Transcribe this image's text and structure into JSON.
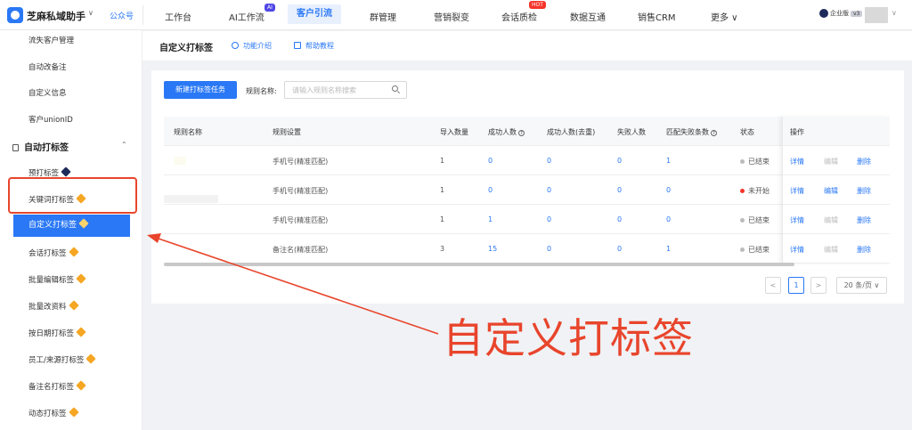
{
  "header": {
    "app_name": "芝麻私域助手",
    "app_caret": "∨",
    "mp_link": "公众号",
    "nav": [
      "工作台",
      "AI工作流",
      "客户引流",
      "群管理",
      "营销裂变",
      "会话质检",
      "数据互通",
      "销售CRM",
      "更多 ∨"
    ],
    "badge_ai": "AI",
    "badge_hot": "HOT",
    "enterprise": "企业版",
    "version": "v3",
    "avatar_caret": "∨"
  },
  "sidebar": {
    "top_items": [
      "流失客户管理",
      "自动改备注",
      "自定义信息",
      "客户unionID"
    ],
    "group": "自动打标签",
    "group_caret": "⌃",
    "items": [
      "预打标签",
      "关键词打标签",
      "自定义打标签",
      "会话打标签",
      "批量编辑标签",
      "批量改资料",
      "按日期打标签",
      "员工/来源打标签",
      "备注名打标签",
      "动态打标签"
    ]
  },
  "page": {
    "title": "自定义打标签",
    "link_intro": "功能介绍",
    "link_help": "帮助教程"
  },
  "toolbar": {
    "new_button": "新建打标签任务",
    "rule_label": "规则名称:",
    "search_placeholder": "请输入规则名称搜索"
  },
  "table": {
    "columns": [
      "规则名称",
      "规则设置",
      "导入数量",
      "成功人数",
      "成功人数(去重)",
      "失败人数",
      "匹配失败条数",
      "状态",
      "操作"
    ],
    "rows": [
      {
        "setting": "手机号(精准匹配)",
        "imported": "1",
        "success": "0",
        "success_dedup": "0",
        "failed": "0",
        "match_failed": "1",
        "status": "已结束",
        "status_color": "#bbbbbb",
        "actions": [
          "详情",
          "编辑",
          "删除"
        ],
        "edit_enabled": false
      },
      {
        "setting": "手机号(精准匹配)",
        "imported": "1",
        "success": "0",
        "success_dedup": "0",
        "failed": "0",
        "match_failed": "0",
        "status": "未开始",
        "status_color": "#f5342a",
        "actions": [
          "详情",
          "编辑",
          "删除"
        ],
        "edit_enabled": true
      },
      {
        "setting": "手机号(精准匹配)",
        "imported": "1",
        "success": "1",
        "success_dedup": "0",
        "failed": "0",
        "match_failed": "0",
        "status": "已结束",
        "status_color": "#bbbbbb",
        "actions": [
          "详情",
          "编辑",
          "删除"
        ],
        "edit_enabled": false
      },
      {
        "setting": "备注名(精准匹配)",
        "imported": "3",
        "success": "15",
        "success_dedup": "0",
        "failed": "0",
        "match_failed": "1",
        "status": "已结束",
        "status_color": "#bbbbbb",
        "actions": [
          "详情",
          "编辑",
          "删除"
        ],
        "edit_enabled": false
      }
    ]
  },
  "pagination": {
    "prev": "<",
    "current": "1",
    "next": ">",
    "page_size": "20 条/页 ∨"
  },
  "annotation": {
    "text": "自定义打标签",
    "color": "#e8452c"
  },
  "colors": {
    "primary": "#2a78f6",
    "annotation_red": "#e8452c"
  }
}
